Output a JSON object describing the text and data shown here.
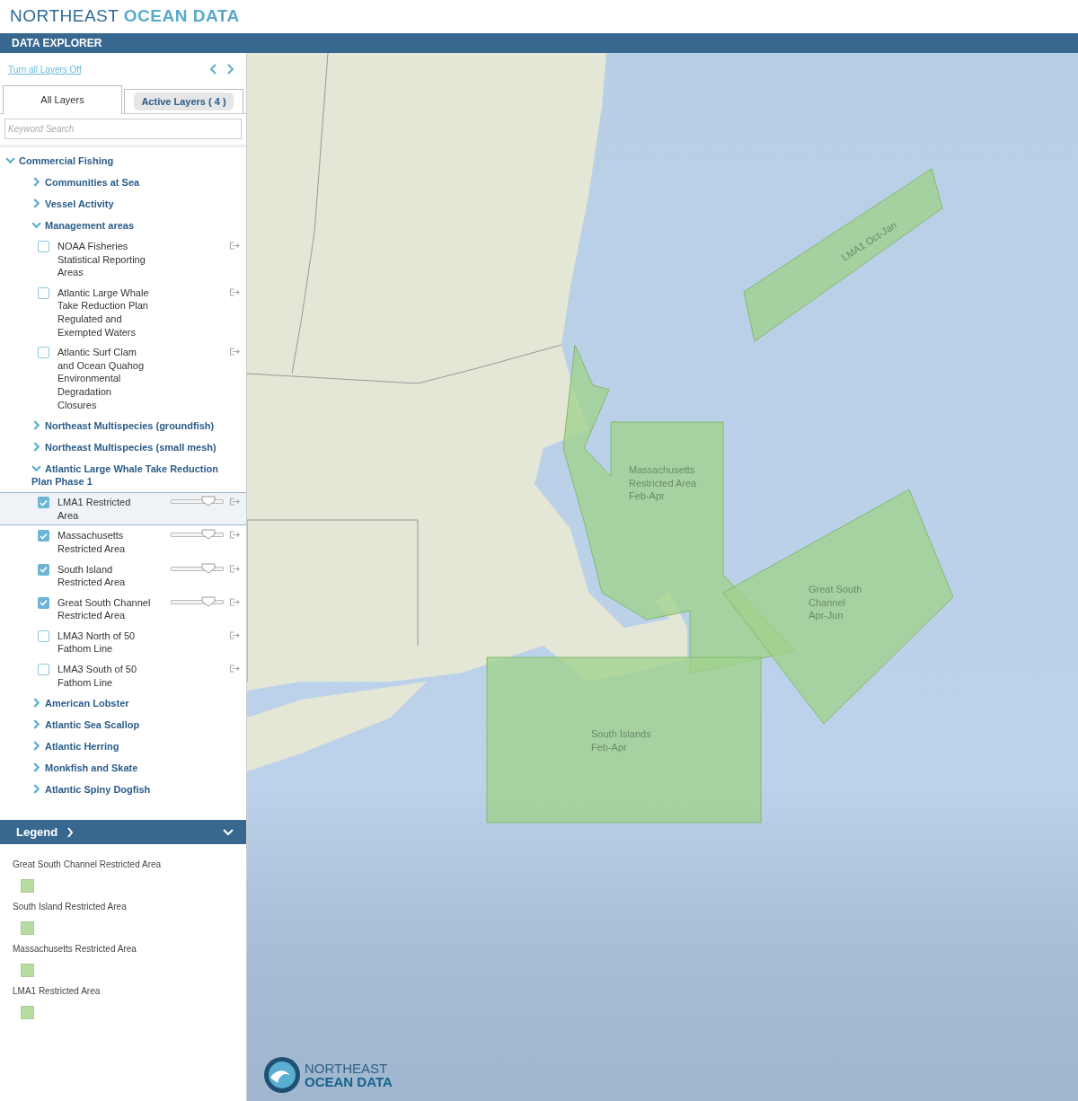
{
  "header": {
    "brand_light": "NORTHEAST",
    "brand_bold": "OCEAN DATA"
  },
  "toolbar": {
    "title": "DATA EXPLORER"
  },
  "panel": {
    "turn_off_link": "Turn all Layers Off",
    "tabs": [
      {
        "label": "All Layers",
        "selected": true
      },
      {
        "label": "Active Layers ( 4 )",
        "selected": false
      }
    ],
    "search": {
      "placeholder": "Keyword Search"
    },
    "tree": [
      {
        "kind": "group",
        "label": "Commercial Fishing",
        "expanded": true,
        "children": [
          {
            "kind": "group",
            "label": "Communities at Sea",
            "expanded": false
          },
          {
            "kind": "group",
            "label": "Vessel Activity",
            "expanded": false
          },
          {
            "kind": "group",
            "label": "Management areas",
            "expanded": true,
            "children": [
              {
                "kind": "layer",
                "label": "NOAA Fisheries Statistical Reporting Areas",
                "checked": false,
                "selected": false
              },
              {
                "kind": "layer",
                "label": "Atlantic Large Whale Take Reduction Plan Regulated and Exempted Waters",
                "checked": false,
                "selected": false
              },
              {
                "kind": "layer",
                "label": "Atlantic Surf Clam and Ocean Quahog Environmental Degradation Closures",
                "checked": false,
                "selected": false
              }
            ]
          },
          {
            "kind": "group",
            "label": "Northeast Multispecies (groundfish)",
            "expanded": false
          },
          {
            "kind": "group",
            "label": "Northeast Multispecies (small mesh)",
            "expanded": false
          },
          {
            "kind": "group",
            "label": "Atlantic Large Whale Take Reduction Plan Phase 1",
            "expanded": true,
            "children": [
              {
                "kind": "layer",
                "label": "LMA1 Restricted Area",
                "checked": true,
                "selected": true,
                "opacity": {
                  "level": 0.72
                }
              },
              {
                "kind": "layer",
                "label": "Massachusetts Restricted Area",
                "checked": true,
                "selected": false,
                "opacity": {
                  "level": 0.72
                }
              },
              {
                "kind": "layer",
                "label": "South Island Restricted Area",
                "checked": true,
                "selected": false,
                "opacity": {
                  "level": 0.72
                }
              },
              {
                "kind": "layer",
                "label": "Great South Channel Restricted Area",
                "checked": true,
                "selected": false,
                "opacity": {
                  "level": 0.72
                }
              },
              {
                "kind": "layer",
                "label": "LMA3 North of 50 Fathom Line",
                "checked": false,
                "selected": false
              },
              {
                "kind": "layer",
                "label": "LMA3 South of 50 Fathom Line",
                "checked": false,
                "selected": false
              }
            ]
          },
          {
            "kind": "group",
            "label": "American Lobster",
            "expanded": false
          },
          {
            "kind": "group",
            "label": "Atlantic Sea Scallop",
            "expanded": false
          },
          {
            "kind": "group",
            "label": "Atlantic Herring",
            "expanded": false
          },
          {
            "kind": "group",
            "label": "Monkfish and Skate",
            "expanded": false
          },
          {
            "kind": "group",
            "label": "Atlantic Spiny Dogfish",
            "expanded": false
          }
        ]
      }
    ]
  },
  "legend": {
    "title": "Legend",
    "expanded": true,
    "items": [
      {
        "label": "Great South Channel Restricted Area"
      },
      {
        "label": "South Island Restricted Area"
      },
      {
        "label": "Massachusetts Restricted Area"
      },
      {
        "label": "LMA1 Restricted Area"
      }
    ]
  },
  "map": {
    "areas": [
      {
        "label_lines": [
          "LMA1 Oct-Jan"
        ]
      },
      {
        "label_lines": [
          "Massachusetts",
          "Restricted Area",
          "Feb-Apr"
        ]
      },
      {
        "label_lines": [
          "South Islands",
          "Feb-Apr"
        ]
      },
      {
        "label_lines": [
          "Great South",
          "Channel",
          "Apr-Jun"
        ]
      }
    ],
    "logo": {
      "line1": "NORTHEAST",
      "line2": "OCEAN DATA"
    }
  }
}
